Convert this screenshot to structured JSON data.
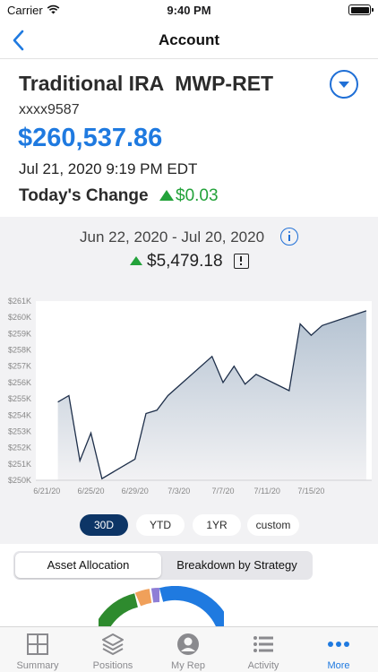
{
  "status_bar": {
    "carrier": "Carrier",
    "time": "9:40 PM"
  },
  "nav": {
    "title": "Account"
  },
  "account": {
    "name": "Traditional IRA  MWP-RET",
    "number": "xxxx9587",
    "balance": "$260,537.86",
    "timestamp": "Jul 21, 2020 9:19 PM EDT",
    "todays_change_label": "Today's Change",
    "todays_change_value": "$0.03"
  },
  "performance": {
    "date_range": "Jun 22, 2020 - Jul 20, 2020",
    "change": "$5,479.18"
  },
  "chart_data": {
    "type": "area",
    "y_ticks": [
      "$250K",
      "$251K",
      "$252K",
      "$253K",
      "$254K",
      "$255K",
      "$256K",
      "$257K",
      "$258K",
      "$259K",
      "$260K",
      "$261K"
    ],
    "x_ticks": [
      "6/21/20",
      "6/25/20",
      "6/29/20",
      "7/3/20",
      "7/7/20",
      "7/11/20",
      "7/15/20"
    ],
    "ylim": [
      250000,
      261000
    ],
    "points": [
      {
        "x": "2020-06-22",
        "y": 254800
      },
      {
        "x": "2020-06-23",
        "y": 255200
      },
      {
        "x": "2020-06-24",
        "y": 251200
      },
      {
        "x": "2020-06-25",
        "y": 252900
      },
      {
        "x": "2020-06-26",
        "y": 250100
      },
      {
        "x": "2020-06-29",
        "y": 251300
      },
      {
        "x": "2020-06-30",
        "y": 254100
      },
      {
        "x": "2020-07-01",
        "y": 254300
      },
      {
        "x": "2020-07-02",
        "y": 255200
      },
      {
        "x": "2020-07-06",
        "y": 257600
      },
      {
        "x": "2020-07-07",
        "y": 256000
      },
      {
        "x": "2020-07-08",
        "y": 257000
      },
      {
        "x": "2020-07-09",
        "y": 255900
      },
      {
        "x": "2020-07-10",
        "y": 256500
      },
      {
        "x": "2020-07-13",
        "y": 255500
      },
      {
        "x": "2020-07-14",
        "y": 259600
      },
      {
        "x": "2020-07-15",
        "y": 258900
      },
      {
        "x": "2020-07-16",
        "y": 259500
      },
      {
        "x": "2020-07-20",
        "y": 260400
      }
    ],
    "grid": false,
    "colors": {
      "line": "#1e2f4a",
      "fill_top": "#b5c3d2",
      "fill_bottom": "#f2f2f4"
    }
  },
  "ranges": [
    {
      "label": "30D",
      "active": true
    },
    {
      "label": "YTD",
      "active": false
    },
    {
      "label": "1YR",
      "active": false
    },
    {
      "label": "custom",
      "active": false
    }
  ],
  "segments": [
    {
      "label": "Asset Allocation",
      "active": true
    },
    {
      "label": "Breakdown by Strategy",
      "active": false
    }
  ],
  "allocation_colors": [
    "#1f7ae0",
    "#2e8b2e",
    "#f0a05a",
    "#8e7ed6"
  ],
  "tabs": [
    {
      "label": "Summary",
      "icon": "grid-icon",
      "active": false
    },
    {
      "label": "Positions",
      "icon": "layers-icon",
      "active": false
    },
    {
      "label": "My Rep",
      "icon": "person-icon",
      "active": false
    },
    {
      "label": "Activity",
      "icon": "list-icon",
      "active": false
    },
    {
      "label": "More",
      "icon": "more-icon",
      "active": true
    }
  ],
  "colors": {
    "accent": "#1f7ae0",
    "positive": "#23a23a",
    "dark_navy": "#0d3566"
  }
}
